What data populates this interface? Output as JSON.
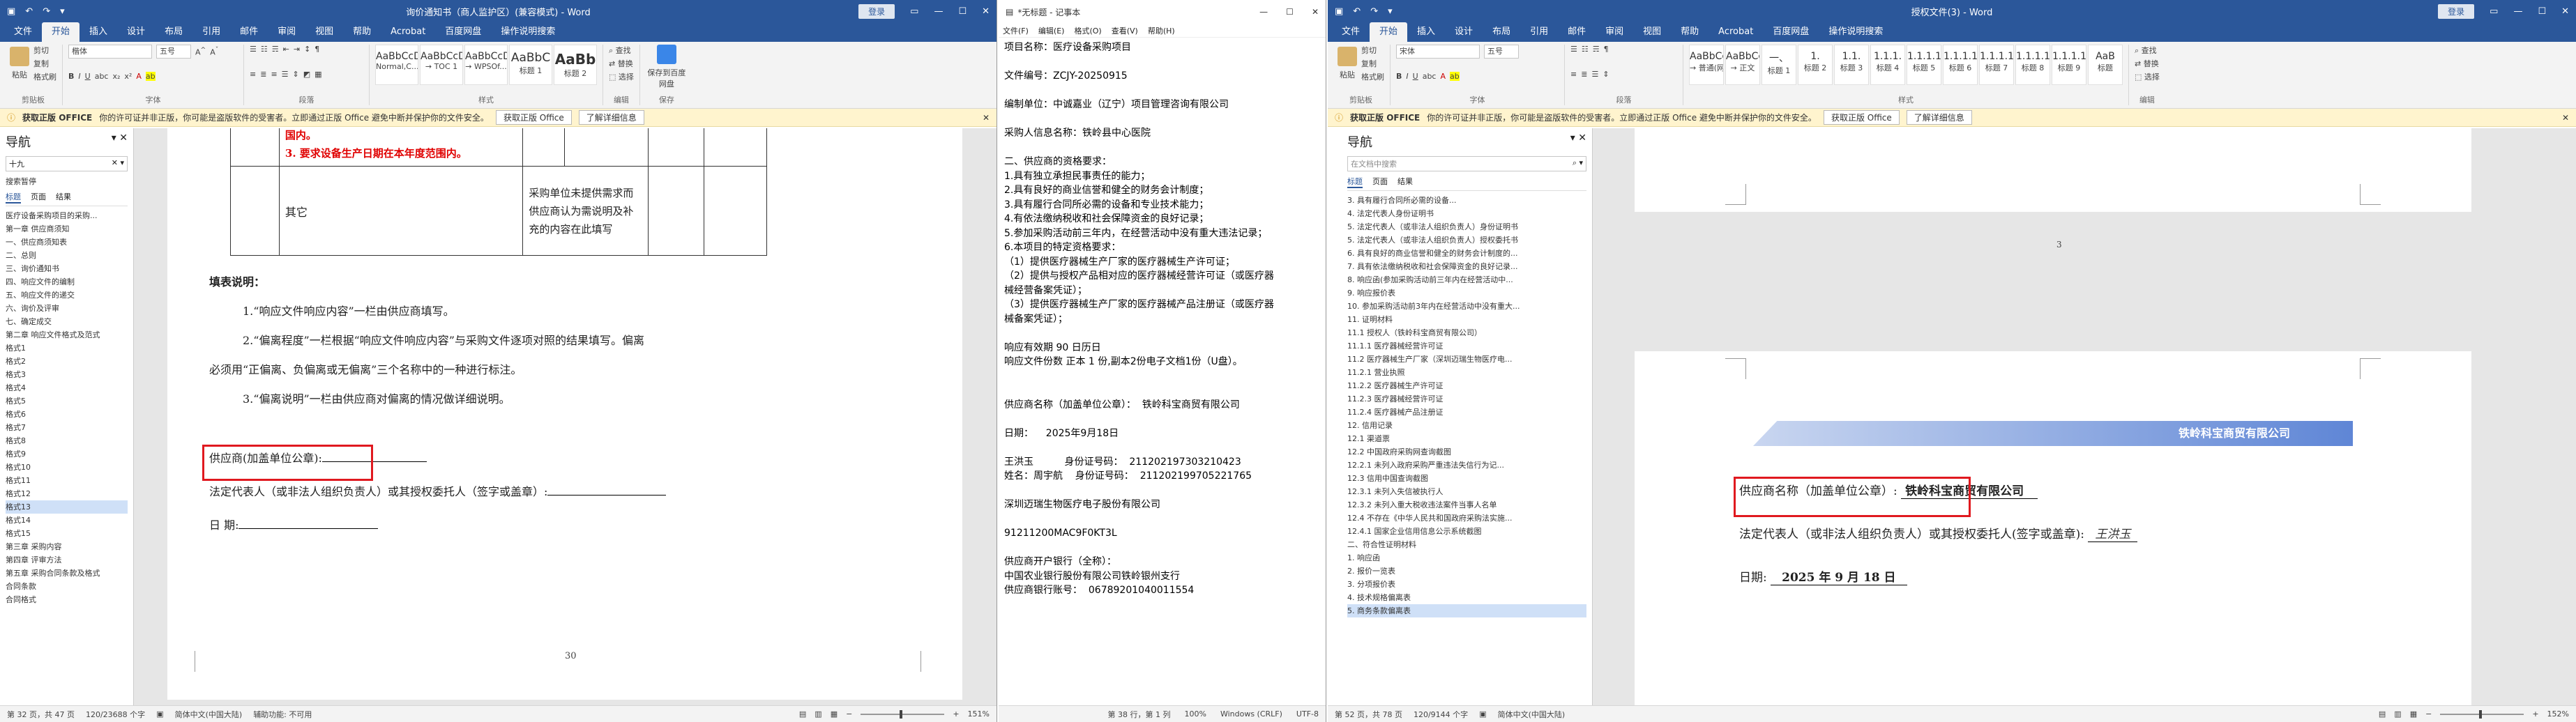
{
  "w1": {
    "title": "询价通知书（商人监护区）(兼容模式) - Word",
    "signin": "登录",
    "tabs": [
      "文件",
      "开始",
      "插入",
      "设计",
      "布局",
      "引用",
      "邮件",
      "审阅",
      "视图",
      "帮助",
      "Acrobat",
      "百度网盘",
      "操作说明搜索"
    ],
    "ribbon": {
      "paste": "粘贴",
      "cut": "剪切",
      "copy": "复制",
      "format_painter": "格式刷",
      "clipboard": "剪贴板",
      "font_name": "楷体",
      "font_size": "五号",
      "font": "字体",
      "paragraph": "段落",
      "styles": [
        {
          "s": "AaBbCcDd",
          "n": "Normal,C..."
        },
        {
          "s": "AaBbCcDd",
          "n": "→ TOC 1"
        },
        {
          "s": "AaBbCcDd",
          "n": "→ WPSOf..."
        },
        {
          "s": "AaBbC",
          "n": "标题 1"
        },
        {
          "s": "AaBb",
          "n": "标题 2"
        }
      ],
      "styles_label": "样式",
      "find": "查找",
      "replace": "替换",
      "select": "选择",
      "editing": "编辑",
      "save": "保存到百度网盘",
      "save_group": "保存"
    },
    "warn": {
      "label": "获取正版 OFFICE",
      "text": "你的许可证并非正版，你可能是盗版软件的受害者。立即通过正版 Office 避免中断并保护你的文件安全。",
      "btn1": "获取正版 Office",
      "btn2": "了解详细信息"
    },
    "nav": {
      "title": "导航",
      "search": "十九",
      "tabs": [
        "标题",
        "页面",
        "结果"
      ],
      "results": "搜索暂停",
      "items": [
        "医疗设备采购项目的采购...",
        "第一章 供应商须知",
        "一、供应商须知表",
        "二、总则",
        "三、询价通知书",
        "四、响应文件的编制",
        "五、响应文件的递交",
        "六、询价及评审",
        "七、确定成交",
        "第二章 响应文件格式及范式",
        "格式1",
        "格式2",
        "格式3",
        "格式4",
        "格式5",
        "格式6",
        "格式7",
        "格式8",
        "格式9",
        "格式10",
        "格式11",
        "格式12",
        "格式13",
        "格式14",
        "格式15",
        "第三章 采购内容",
        "第四章 评审方法",
        "第五章 采购合同条款及格式",
        "合同条款",
        "合同格式"
      ],
      "selected": 22
    },
    "doc": {
      "red1": "国内。",
      "red2": "3. 要求设备生产日期在本年度范围内。",
      "other": "其它",
      "note": "采购单位未提供需求而供应商认为需说明及补充的内容在此填写",
      "fill_title": "填表说明：",
      "fill1": "1.“响应文件响应内容”一栏由供应商填写。",
      "fill2": "2.“偏离程度”一栏根据“响应文件响应内容”与采购文件逐项对照的结果填写。偏离",
      "fill2b": "必须用“正偏离、负偏离或无偏离”三个名称中的一种进行标注。",
      "fill3": "3.“偏离说明”一栏由供应商对偏离的情况做详细说明。",
      "supplier": "供应商(加盖单位公章):",
      "rep": "法定代表人（或非法人组织负责人）或其授权委托人（签字或盖章）:",
      "date": "日    期:",
      "pageno": "30"
    },
    "status": {
      "page": "第 32 页，共 47 页",
      "words": "120/23688 个字",
      "lang": "简体中文(中国大陆)",
      "assist": "辅助功能: 不可用",
      "zoom": "151%"
    }
  },
  "w2": {
    "title": "*无标题 - 记事本",
    "menu": [
      "文件(F)",
      "编辑(E)",
      "格式(O)",
      "查看(V)",
      "帮助(H)"
    ],
    "lines": [
      "项目名称：医疗设备采购项目",
      "",
      "文件编号：ZCJY-20250915",
      "",
      "编制单位：中诚嘉业（辽宁）项目管理咨询有限公司",
      "",
      "采购人信息名称：铁岭县中心医院",
      "",
      "二、供应商的资格要求：",
      "1.具有独立承担民事责任的能力；",
      "2.具有良好的商业信誉和健全的财务会计制度；",
      "3.具有履行合同所必需的设备和专业技术能力；",
      "4.有依法缴纳税收和社会保障资金的良好记录；",
      "5.参加采购活动前三年内，在经营活动中没有重大违法记录；",
      "6.本项目的特定资格要求：",
      "（1）提供医疗器械生产厂家的医疗器械生产许可证；",
      "（2）提供与授权产品相对应的医疗器械经营许可证（或医疗器",
      "械经营备案凭证）；",
      "（3）提供医疗器械生产厂家的医疗器械产品注册证（或医疗器",
      "械备案凭证）；",
      "",
      "响应有效期 90 日历日",
      "响应文件份数 正本 1 份,副本2份电子文档1份（U盘）。",
      "",
      "",
      "供应商名称（加盖单位公章）：  铁岭科宝商贸有限公司",
      "",
      "日期：    2025年9月18日",
      "",
      "王洪玉          身份证号码：  211202197303210423",
      "姓名：周宇航    身份证号码：  211202199705221765",
      "",
      "深圳迈瑞生物医疗电子股份有限公司",
      "",
      "91211200MAC9F0KT3L",
      "",
      "供应商开户银行（全称）：",
      "中国农业银行股份有限公司铁岭银州支行",
      "供应商银行账号：  06789201040011554"
    ],
    "status": {
      "pos": "第 38 行，第 1 列",
      "zoom": "100%",
      "eol": "Windows (CRLF)",
      "enc": "UTF-8"
    }
  },
  "w3": {
    "title": "授权文件(3) - Word",
    "signin": "登录",
    "tabs": [
      "文件",
      "开始",
      "插入",
      "设计",
      "布局",
      "引用",
      "邮件",
      "审阅",
      "视图",
      "帮助",
      "Acrobat",
      "百度网盘",
      "操作说明搜索"
    ],
    "ribbon": {
      "font_name": "宋体",
      "font_size": "五号",
      "styles": [
        {
          "s": "AaBbCcDd",
          "n": "→ 普通(网站)"
        },
        {
          "s": "AaBbCcDd",
          "n": "→ 正文"
        },
        {
          "s": "一、",
          "n": "标题 1"
        },
        {
          "s": "1.",
          "n": "标题 2"
        },
        {
          "s": "1.1.",
          "n": "标题 3"
        },
        {
          "s": "1.1.1.",
          "n": "标题 4"
        },
        {
          "s": "1.1.1.1",
          "n": "标题 5"
        },
        {
          "s": "1.1.1.1.1",
          "n": "标题 6"
        },
        {
          "s": "1.1.1.1.1",
          "n": "标题 7"
        },
        {
          "s": "1.1.1.1.1",
          "n": "标题 8"
        },
        {
          "s": "1.1.1.1.1",
          "n": "标题 9"
        },
        {
          "s": "AaB",
          "n": "标题"
        }
      ]
    },
    "nav": {
      "title": "导航",
      "search": "在文档中搜索",
      "tabs": [
        "标题",
        "页面",
        "结果"
      ],
      "items": [
        "3. 具有履行合同所必需的设备...",
        "4. 法定代表人身份证明书",
        "5. 法定代表人（或非法人组织负责人）身份证明书",
        "5. 法定代表人（或非法人组织负责人）授权委托书",
        "6. 具有良好的商业信誉和健全的财务会计制度的...",
        "7. 具有依法缴纳税收和社会保障资金的良好记录...",
        "8. 响应函(参加采购活动前三年内在经营活动中...",
        "9. 响应报价表",
        "10. 参加采购活动前3年内在经营活动中没有重大...",
        "11. 证明材料",
        "11.1 授权人（铁岭科宝商贸有限公司）",
        "11.1.1 医疗器械经营许可证",
        "11.2 医疗器械生产厂家（深圳迈瑞生物医疗电...",
        "11.2.1 营业执照",
        "11.2.2 医疗器械生产许可证",
        "11.2.3 医疗器械经营许可证",
        "11.2.4 医疗器械产品注册证",
        "12. 信用记录",
        "12.1 渠道票",
        "12.2 中国政府采购网查询截图",
        "12.2.1 未列入政府采购严重违法失信行为记...",
        "12.3 信用中国查询截图",
        "12.3.1 未列入失信被执行人",
        "12.3.2 未列入重大税收违法案件当事人名单",
        "12.4 不存在《中华人民共和国政府采购法实施...",
        "12.4.1 国家企业信用信息公示系统截图",
        "二、符合性证明材料",
        "1. 响应函",
        "2. 报价一览表",
        "3. 分项报价表",
        "4. 技术规格偏离表",
        "5. 商务条款偏离表"
      ],
      "selected": 31
    },
    "doc": {
      "pageno3": "3",
      "banner": "铁岭科宝商贸有限公司",
      "supplier_label": "供应商名称（加盖单位公章）:",
      "supplier_value": "铁岭科宝商贸有限公司",
      "rep": "法定代表人（或非法人组织负责人）或其授权委托人(签字或盖章):",
      "sign": "王洪玉",
      "date_label": "日期:",
      "date_value": "2025 年 9 月 18 日"
    },
    "status": {
      "page": "第 52 页，共 78 页",
      "words": "120/9144 个字",
      "lang": "简体中文(中国大陆)",
      "zoom": "152%"
    }
  },
  "colors": {
    "word_blue": "#2b579a",
    "highlight_red": "#e0191f",
    "doc_red": "#e00000"
  }
}
